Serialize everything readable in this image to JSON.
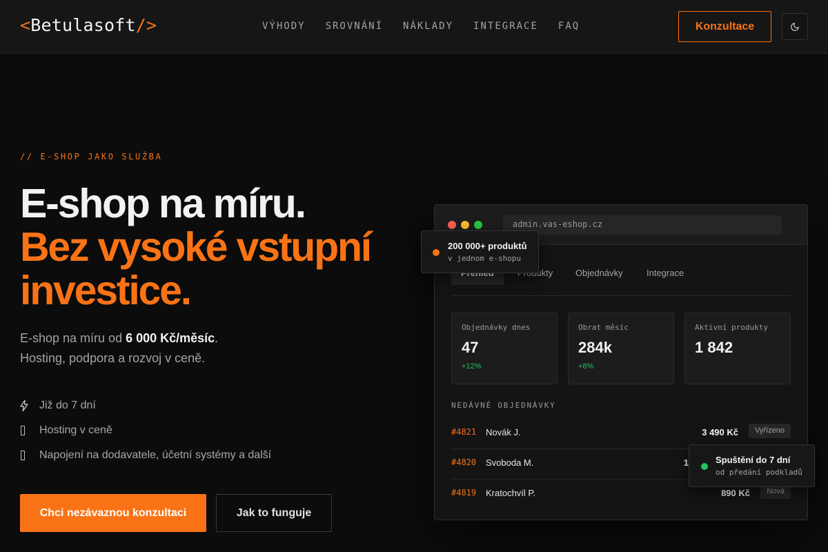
{
  "header": {
    "logo": {
      "open": "<",
      "name": "Betulasoft",
      "close": "/>"
    },
    "nav": [
      "VÝHODY",
      "SROVNÁNÍ",
      "NÁKLADY",
      "INTEGRACE",
      "FAQ"
    ],
    "cta_label": "Konzultace",
    "theme_icon": "moon-icon"
  },
  "hero": {
    "eyebrow": "// E-SHOP JAKO SLUŽBA",
    "title_line1": "E-shop na míru.",
    "title_line2": "Bez vysoké vstupní",
    "title_line3": "investice.",
    "subtitle_prefix": "E-shop na míru od ",
    "subtitle_price": "6 000 Kč/měsíc",
    "subtitle_suffix": ".",
    "subtitle_line2": "Hosting, podpora a rozvoj v ceně.",
    "features": [
      {
        "icon": "lightning-icon",
        "label": "Již do 7 dní"
      },
      {
        "icon": "box-icon",
        "label": "Hosting v ceně"
      },
      {
        "icon": "box-icon",
        "label": "Napojení na dodavatele, účetní systémy a další"
      }
    ],
    "primary_button": "Chci nezávaznou konzultaci",
    "secondary_button": "Jak to funguje"
  },
  "mockup": {
    "url": "admin.vas-eshop.cz",
    "tabs": [
      "Přehled",
      "Produkty",
      "Objednávky",
      "Integrace"
    ],
    "active_tab": "Přehled",
    "stats": [
      {
        "label": "Objednávky dnes",
        "value": "47",
        "delta": "+12%"
      },
      {
        "label": "Obrat měsíc",
        "value": "284k",
        "delta": "+8%"
      },
      {
        "label": "Aktivní produkty",
        "value": "1 842",
        "delta": ""
      }
    ],
    "recent_title": "NEDÁVNÉ OBJEDNÁVKY",
    "orders": [
      {
        "id": "#4821",
        "customer": "Novák J.",
        "amount": "3 490 Kč",
        "status": "Vyřízeno"
      },
      {
        "id": "#4820",
        "customer": "Svoboda M.",
        "amount": "1",
        "status": ""
      },
      {
        "id": "#4819",
        "customer": "Kratochvíl P.",
        "amount": "890 Kč",
        "status": "Nová"
      }
    ]
  },
  "toasts": {
    "products": {
      "title": "200 000+ produktů",
      "subtitle": "v jednom e-shopu"
    },
    "launch": {
      "title": "Spuštění do 7 dní",
      "subtitle": "od předání podkladů"
    }
  },
  "colors": {
    "accent": "#f97316",
    "background": "#0c0c0c",
    "positive": "#22c55e",
    "dot_red": "#ff5f57",
    "dot_yellow": "#febc2e",
    "dot_green": "#28c840"
  }
}
